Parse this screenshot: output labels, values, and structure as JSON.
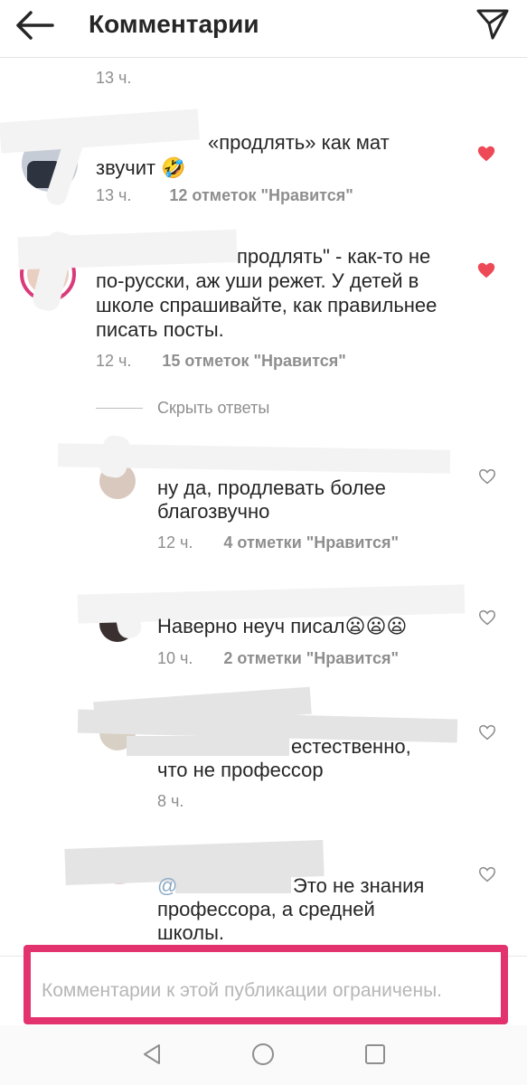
{
  "header": {
    "title": "Комментарии"
  },
  "top_time": "13 ч.",
  "comments": [
    {
      "text_line1": "«продлять» как мат",
      "text_line2": "звучит 🤣",
      "time": "13 ч.",
      "likes": "12 отметок \"Нравится\"",
      "liked": true
    },
    {
      "text_line1": "продлять\" - как-то не",
      "text_line2": "по-русски, аж уши режет. У детей в",
      "text_line3": "школе спрашивайте, как правильнее",
      "text_line4": "писать посты.",
      "time": "12 ч.",
      "likes": "15 отметок \"Нравится\"",
      "liked": true
    }
  ],
  "hide_replies": "Скрыть ответы",
  "replies": [
    {
      "text_line1": "ну да, продлевать более",
      "text_line2": "благозвучно",
      "time": "12 ч.",
      "likes": "4 отметки \"Нравится\""
    },
    {
      "text_line1": "Наверно неуч писал😦😦😦",
      "time": "10 ч.",
      "likes": "2 отметки \"Нравится\""
    },
    {
      "text_line1": "естественно,",
      "text_line2": "что не профессор",
      "time": "8 ч."
    },
    {
      "text_line1": "@",
      "text_line1b": "Это не знания",
      "text_line2": "профессора, а  средней",
      "text_line3": "школы."
    }
  ],
  "footer": {
    "restricted_text": "Комментарии к этой публикации ограничены."
  },
  "colors": {
    "heart_liked": "#ed4956",
    "highlight_border": "#e3336e",
    "muted_text": "#8e8e8e"
  }
}
